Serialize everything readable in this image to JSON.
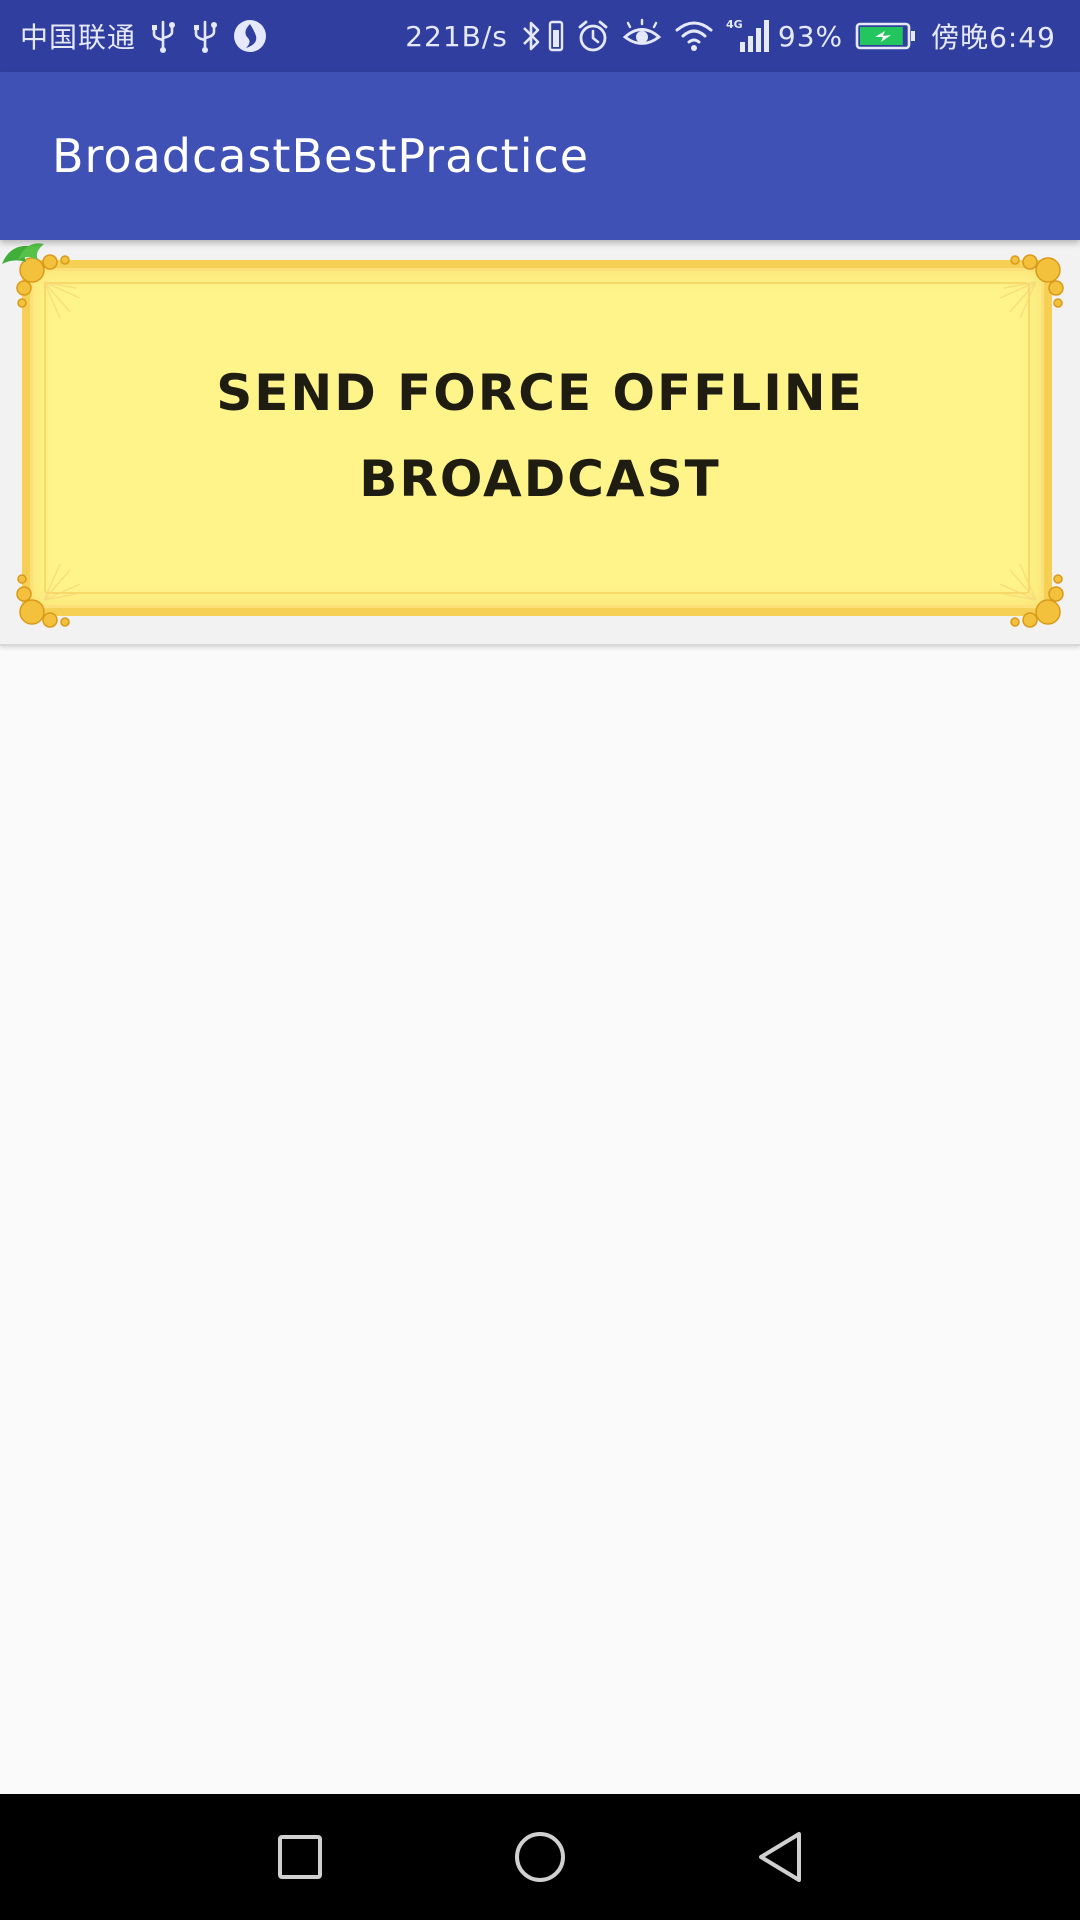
{
  "status_bar": {
    "carrier": "中国联通",
    "speed": "221B/s",
    "battery_percent": "93%",
    "time": "傍晚6:49",
    "battery_level": 0.93,
    "icons_left": [
      "usb-icon",
      "usb-icon",
      "vpn-globe-icon"
    ],
    "icons_right": [
      "bluetooth-icon",
      "vibrate-icon",
      "alarm-icon",
      "eye-comfort-icon",
      "wifi-icon",
      "lte-signal-icon",
      "battery-charging-icon"
    ]
  },
  "app_bar": {
    "title": "BroadcastBestPractice",
    "color": "#3f51b5",
    "status_color": "#303f9f"
  },
  "main": {
    "force_offline_button": {
      "label": "SEND FORCE OFFLINE BROADCAST",
      "fill_color": "#fff48a",
      "border_color": "#f6cf55"
    }
  },
  "nav_bar": {
    "buttons": [
      "recent-apps-icon",
      "home-icon",
      "back-icon"
    ]
  }
}
